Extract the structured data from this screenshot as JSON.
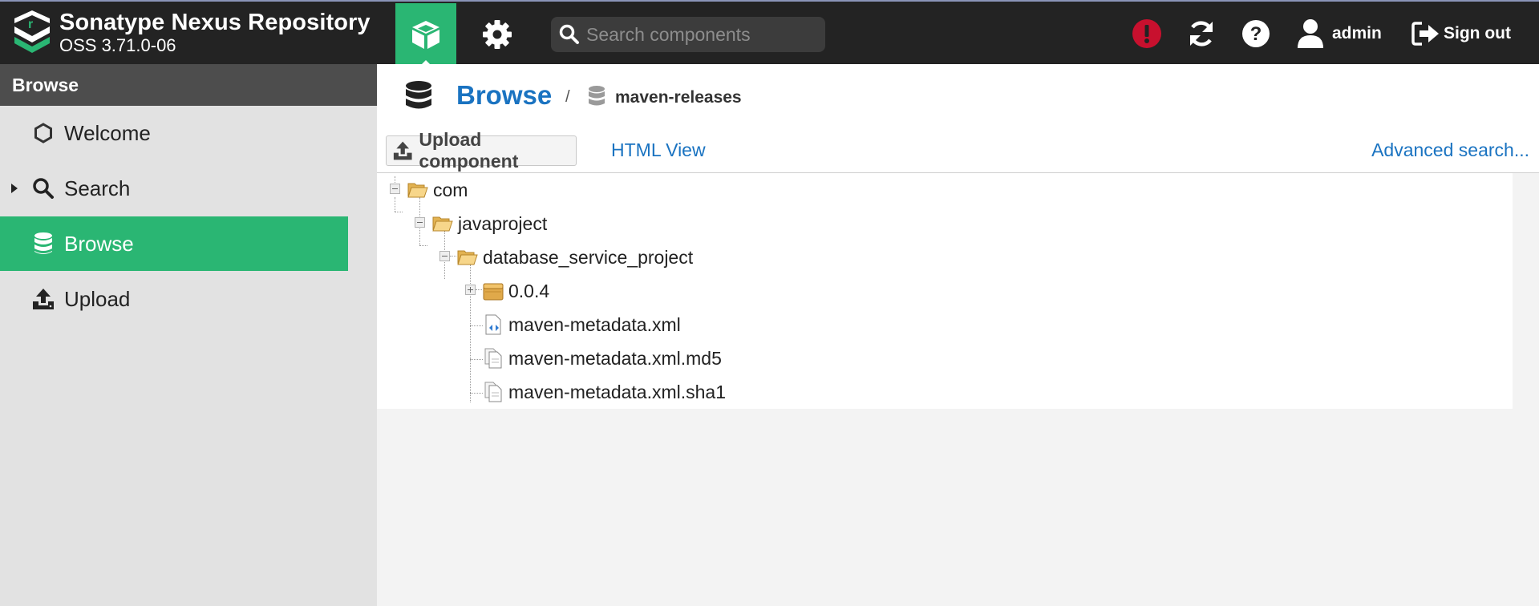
{
  "header": {
    "brand_name": "Sonatype Nexus Repository",
    "brand_version": "OSS 3.71.0-06",
    "search_placeholder": "Search components",
    "user_label": "admin",
    "signout_label": "Sign out",
    "accent_color": "#2ab673",
    "alert_color": "#c8102e",
    "icons": [
      "nexus-logo",
      "cube-icon",
      "gear-icon",
      "search-icon",
      "alert-icon",
      "refresh-icon",
      "help-icon",
      "user-icon",
      "sign-out-icon"
    ]
  },
  "sidebar": {
    "title": "Browse",
    "items": [
      {
        "label": "Welcome",
        "icon": "hexagon-icon",
        "active": false
      },
      {
        "label": "Search",
        "icon": "search-icon",
        "active": false,
        "expandable": true
      },
      {
        "label": "Browse",
        "icon": "database-icon",
        "active": true
      },
      {
        "label": "Upload",
        "icon": "upload-icon",
        "active": false
      }
    ]
  },
  "breadcrumb": {
    "title": "Browse",
    "separator": "/",
    "repository": "maven-releases"
  },
  "toolbar": {
    "upload_label": "Upload component",
    "html_view_label": "HTML View",
    "advanced_search_label": "Advanced search..."
  },
  "tree": {
    "nodes": [
      {
        "label": "com",
        "type": "folder-open",
        "depth": 0,
        "toggle": "minus"
      },
      {
        "label": "javaproject",
        "type": "folder-open",
        "depth": 1,
        "toggle": "minus"
      },
      {
        "label": "database_service_project",
        "type": "folder-open",
        "depth": 2,
        "toggle": "minus"
      },
      {
        "label": "0.0.4",
        "type": "component",
        "depth": 3,
        "toggle": "plus"
      },
      {
        "label": "maven-metadata.xml",
        "type": "xml-file",
        "depth": 3
      },
      {
        "label": "maven-metadata.xml.md5",
        "type": "file",
        "depth": 3
      },
      {
        "label": "maven-metadata.xml.sha1",
        "type": "file",
        "depth": 3
      }
    ]
  }
}
